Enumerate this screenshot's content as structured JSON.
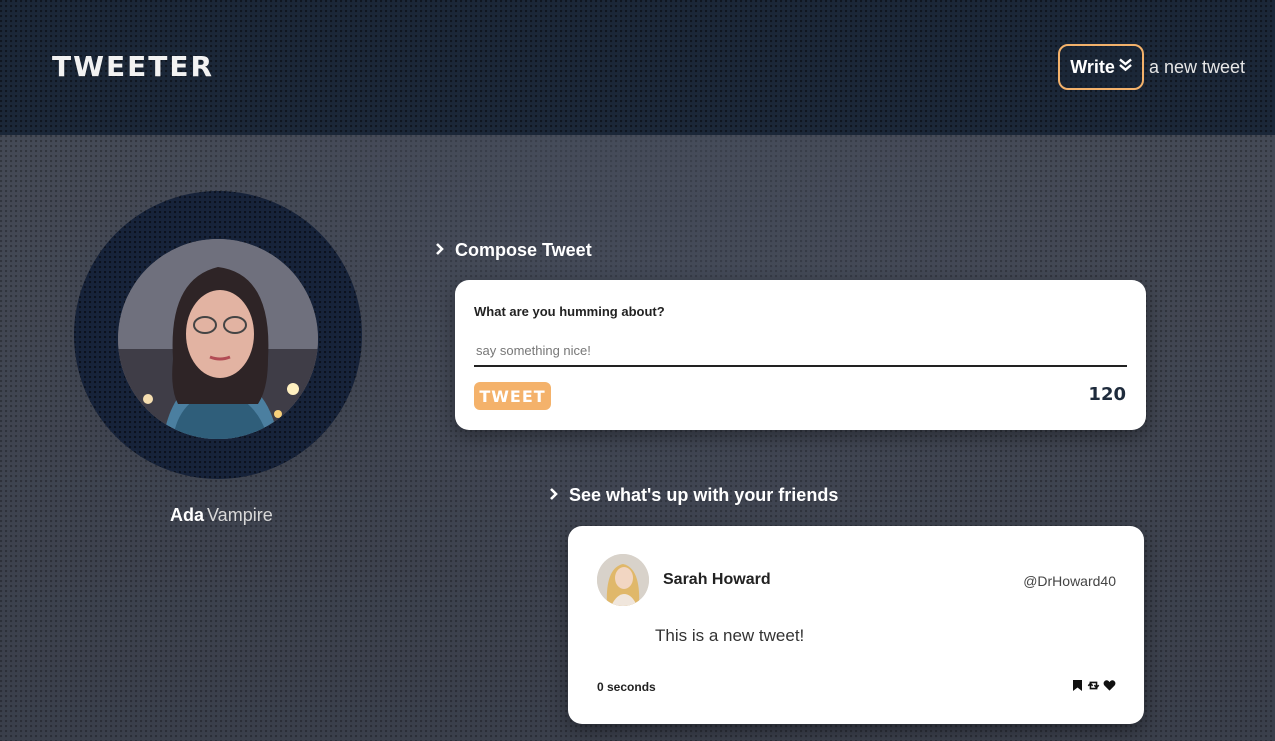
{
  "nav": {
    "brand": "TWEETER",
    "write_label": "Write",
    "write_tail": "a new tweet",
    "accent": "#f4b26b"
  },
  "profile": {
    "first_name": "Ada",
    "last_name": "Vampire"
  },
  "compose": {
    "heading": "Compose Tweet",
    "label": "What are you humming about?",
    "placeholder": "say something nice!",
    "value": "",
    "button_label": "TWEET",
    "counter": "120"
  },
  "feed": {
    "heading": "See what's up with your friends",
    "tweets": [
      {
        "author": "Sarah Howard",
        "handle": "@DrHoward40",
        "body": "This is a new tweet!",
        "time": "0 seconds",
        "actions": [
          "flag-icon",
          "retweet-icon",
          "heart-icon"
        ]
      }
    ]
  }
}
